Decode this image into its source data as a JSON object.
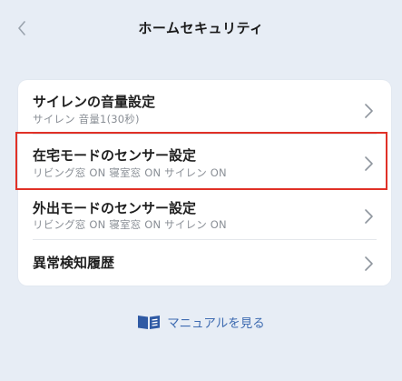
{
  "header": {
    "title": "ホームセキュリティ",
    "back_icon": "chevron-left-icon"
  },
  "menu": {
    "items": [
      {
        "title": "サイレンの音量設定",
        "subtitle": "サイレン 音量1(30秒)"
      },
      {
        "title": "在宅モードのセンサー設定",
        "subtitle": "リビング窓 ON 寝室窓 ON サイレン ON"
      },
      {
        "title": "外出モードのセンサー設定",
        "subtitle": "リビング窓 ON 寝室窓 ON サイレン ON"
      },
      {
        "title": "異常検知履歴",
        "subtitle": ""
      }
    ]
  },
  "manual": {
    "label": "マニュアルを見る",
    "icon": "book-icon"
  },
  "colors": {
    "background": "#e7edf5",
    "card": "#ffffff",
    "highlight": "#e03127",
    "link": "#3e6bb1"
  }
}
